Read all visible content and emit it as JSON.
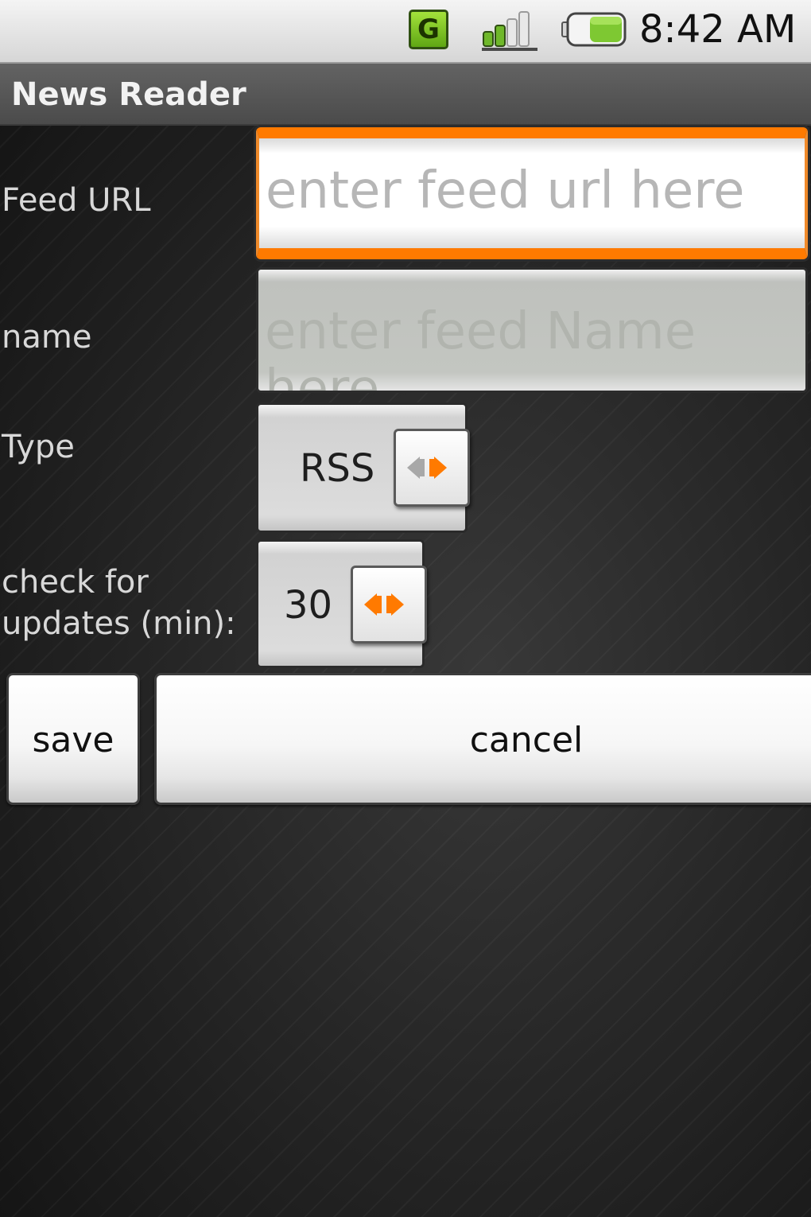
{
  "status_bar": {
    "network_badge": "G",
    "time": "8:42 AM",
    "icons": [
      "network-type-icon",
      "signal-strength-icon",
      "battery-icon"
    ],
    "battery_color": "#7ec832",
    "network_badge_color": "#7ec832"
  },
  "app": {
    "title": "News Reader"
  },
  "form": {
    "feed_url": {
      "label": "Feed URL",
      "placeholder": "enter feed url here",
      "value": "",
      "focused": true,
      "focus_color": "#ff7a00"
    },
    "feed_name": {
      "label": "name",
      "placeholder": "enter feed Name",
      "placeholder_overflow": "here",
      "value": "",
      "enabled": false
    },
    "type": {
      "label": "Type",
      "selected": "RSS"
    },
    "update_interval": {
      "label_line1": "check for",
      "label_line2": "updates (min):",
      "selected": "30"
    }
  },
  "buttons": {
    "save": "save",
    "cancel": "cancel"
  },
  "colors": {
    "accent": "#ff7a00",
    "arrow_disabled": "#a8a8a8"
  }
}
